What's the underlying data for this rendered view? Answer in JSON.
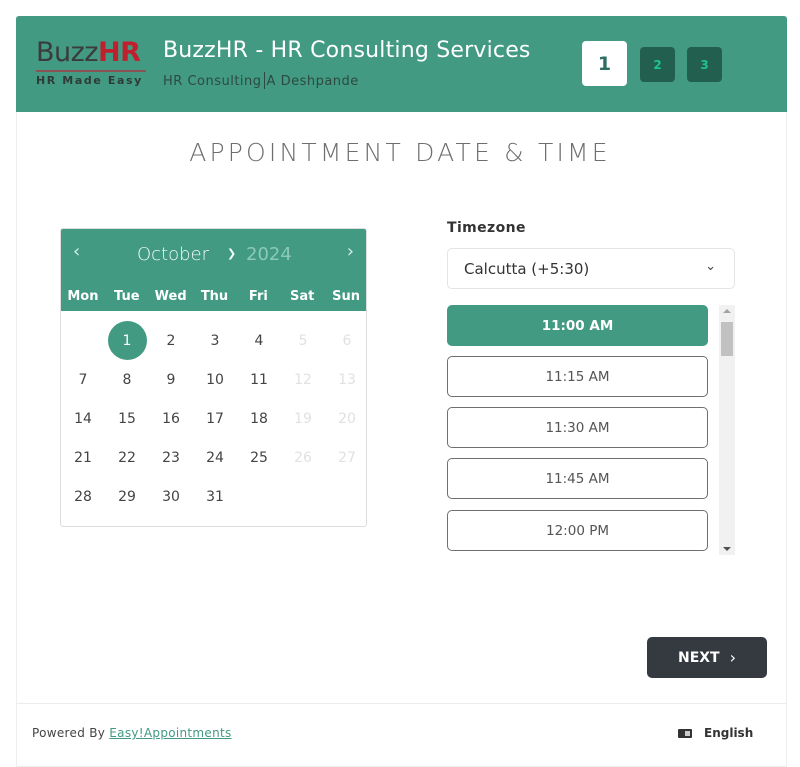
{
  "header": {
    "logo": {
      "word_part1": "Buzz",
      "word_part2": "HR",
      "tagline": "HR Made Easy"
    },
    "title": "BuzzHR - HR Consulting Services",
    "subtitle_left": "HR Consulting",
    "subtitle_right": "A Deshpande",
    "steps": [
      {
        "label": "1",
        "active": true
      },
      {
        "label": "2",
        "active": false
      },
      {
        "label": "3",
        "active": false
      }
    ]
  },
  "page_title": "APPOINTMENT DATE & TIME",
  "calendar": {
    "prev_icon": "‹",
    "next_icon": "›",
    "month": "October",
    "year": "2024",
    "weekdays": [
      "Mon",
      "Tue",
      "Wed",
      "Thu",
      "Fri",
      "Sat",
      "Sun"
    ],
    "selected_day": "1",
    "days": [
      {
        "d": "",
        "s": "empty"
      },
      {
        "d": "1",
        "s": "selected"
      },
      {
        "d": "2",
        "s": "enabled"
      },
      {
        "d": "3",
        "s": "enabled"
      },
      {
        "d": "4",
        "s": "enabled"
      },
      {
        "d": "5",
        "s": "disabled"
      },
      {
        "d": "6",
        "s": "disabled"
      },
      {
        "d": "7",
        "s": "enabled"
      },
      {
        "d": "8",
        "s": "enabled"
      },
      {
        "d": "9",
        "s": "enabled"
      },
      {
        "d": "10",
        "s": "enabled"
      },
      {
        "d": "11",
        "s": "enabled"
      },
      {
        "d": "12",
        "s": "disabled"
      },
      {
        "d": "13",
        "s": "disabled"
      },
      {
        "d": "14",
        "s": "enabled"
      },
      {
        "d": "15",
        "s": "enabled"
      },
      {
        "d": "16",
        "s": "enabled"
      },
      {
        "d": "17",
        "s": "enabled"
      },
      {
        "d": "18",
        "s": "enabled"
      },
      {
        "d": "19",
        "s": "disabled"
      },
      {
        "d": "20",
        "s": "disabled"
      },
      {
        "d": "21",
        "s": "enabled"
      },
      {
        "d": "22",
        "s": "enabled"
      },
      {
        "d": "23",
        "s": "enabled"
      },
      {
        "d": "24",
        "s": "enabled"
      },
      {
        "d": "25",
        "s": "enabled"
      },
      {
        "d": "26",
        "s": "disabled"
      },
      {
        "d": "27",
        "s": "disabled"
      },
      {
        "d": "28",
        "s": "enabled"
      },
      {
        "d": "29",
        "s": "enabled"
      },
      {
        "d": "30",
        "s": "enabled"
      },
      {
        "d": "31",
        "s": "enabled"
      }
    ]
  },
  "timezone": {
    "label": "Timezone",
    "value": "Calcutta (+5:30)"
  },
  "time_slots": [
    {
      "label": "11:00 AM",
      "selected": true
    },
    {
      "label": "11:15 AM",
      "selected": false
    },
    {
      "label": "11:30 AM",
      "selected": false
    },
    {
      "label": "11:45 AM",
      "selected": false
    },
    {
      "label": "12:00 PM",
      "selected": false
    }
  ],
  "next_button": {
    "label": "NEXT",
    "icon": "›"
  },
  "footer": {
    "powered_by": "Powered By",
    "link_text": "Easy!Appointments",
    "language": "English"
  },
  "colors": {
    "brand": "#429a82",
    "step_inactive_bg": "#235f4e",
    "step_inactive_text": "#1ec38e",
    "logo_accent": "#c0202e",
    "next_button_bg": "#343a40"
  }
}
